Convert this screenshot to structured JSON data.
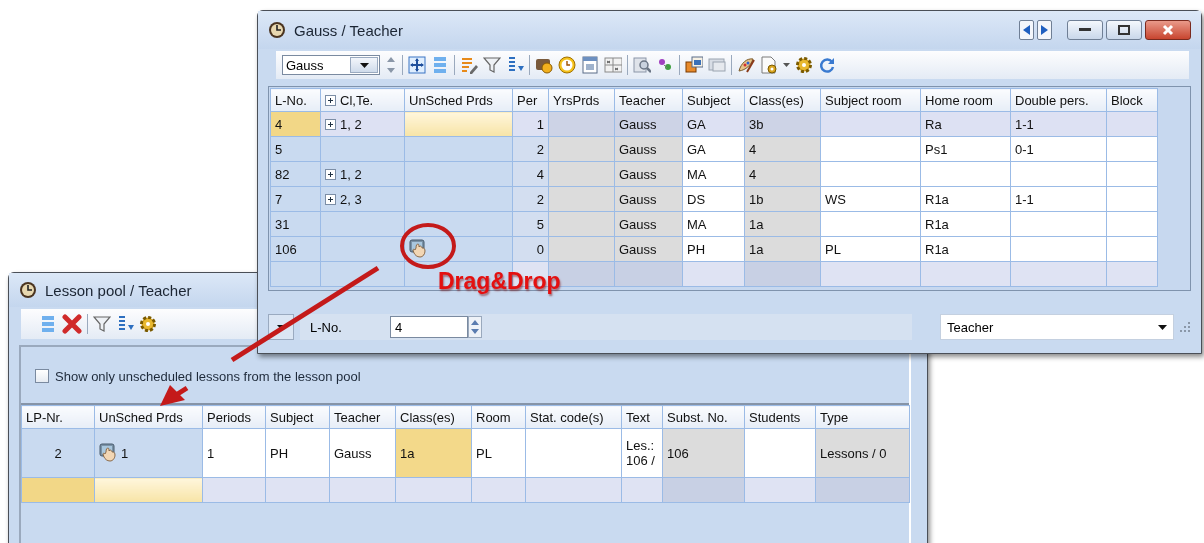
{
  "teacher_window": {
    "title": "Gauss / Teacher",
    "toolbar": {
      "teacher_select": "Gauss"
    },
    "table": {
      "columns": [
        {
          "label": "L-No.",
          "kind": "key"
        },
        {
          "label": "Cl,Te.",
          "kind": "tree"
        },
        {
          "label": "UnSched Prds",
          "kind": "slot"
        },
        {
          "label": "Per",
          "kind": "number"
        },
        {
          "label": "YrsPrds",
          "kind": "grey"
        },
        {
          "label": "Teacher",
          "kind": "grey"
        },
        {
          "label": "Subject",
          "kind": "plain"
        },
        {
          "label": "Class(es)",
          "kind": "grey"
        },
        {
          "label": "Subject room",
          "kind": "plain"
        },
        {
          "label": "Home room",
          "kind": "plain"
        },
        {
          "label": "Double pers.",
          "kind": "plain"
        },
        {
          "label": "Block",
          "kind": "plain"
        }
      ],
      "rows": [
        {
          "selected": true,
          "expandable": true,
          "drag_handle": false,
          "cells": [
            "4",
            "1, 2",
            "",
            "1",
            "",
            "Gauss",
            "GA",
            "3b",
            "",
            "Ra",
            "1-1",
            ""
          ]
        },
        {
          "selected": false,
          "expandable": false,
          "drag_handle": false,
          "cells": [
            "5",
            "",
            "",
            "2",
            "",
            "Gauss",
            "GA",
            "4",
            "",
            "Ps1",
            "0-1",
            ""
          ]
        },
        {
          "selected": false,
          "expandable": true,
          "drag_handle": false,
          "cells": [
            "82",
            "1, 2",
            "",
            "4",
            "",
            "Gauss",
            "MA",
            "4",
            "",
            "",
            "",
            ""
          ]
        },
        {
          "selected": false,
          "expandable": true,
          "drag_handle": false,
          "cells": [
            "7",
            "2, 3",
            "",
            "2",
            "",
            "Gauss",
            "DS",
            "1b",
            "WS",
            "R1a",
            "1-1",
            ""
          ]
        },
        {
          "selected": false,
          "expandable": false,
          "drag_handle": false,
          "cells": [
            "31",
            "",
            "",
            "5",
            "",
            "Gauss",
            "MA",
            "1a",
            "",
            "R1a",
            "",
            ""
          ]
        },
        {
          "selected": false,
          "expandable": false,
          "drag_handle": true,
          "cells": [
            "106",
            "",
            "",
            "0",
            "",
            "Gauss",
            "PH",
            "1a",
            "PL",
            "R1a",
            "",
            ""
          ]
        }
      ],
      "new_row": {
        "selected": false
      }
    },
    "bottom_bar": {
      "field_label": "L-No.",
      "field_value": "4",
      "view_select": "Teacher"
    }
  },
  "annotation": {
    "label": "Drag&Drop"
  },
  "lesson_pool_window": {
    "title": "Lesson pool / Teacher",
    "filter": {
      "label": "Show only unscheduled lessons from the lesson pool",
      "checked": false
    },
    "table": {
      "columns": [
        {
          "label": "LP-Nr.",
          "kind": "key",
          "current": false
        },
        {
          "label": "UnSched Prds",
          "kind": "slot",
          "current": false
        },
        {
          "label": "Periods",
          "kind": "plain",
          "current": false
        },
        {
          "label": "Subject",
          "kind": "plain",
          "current": false
        },
        {
          "label": "Teacher",
          "kind": "plain",
          "current": false
        },
        {
          "label": "Class(es)",
          "kind": "plain",
          "current": true
        },
        {
          "label": "Room",
          "kind": "plain",
          "current": false
        },
        {
          "label": "Stat. code(s)",
          "kind": "plain",
          "current": false
        },
        {
          "label": "Text",
          "kind": "plain",
          "current": false
        },
        {
          "label": "Subst. No.",
          "kind": "grey",
          "current": false
        },
        {
          "label": "Students",
          "kind": "plain",
          "current": false
        },
        {
          "label": "Type",
          "kind": "grey",
          "current": false
        }
      ],
      "rows": [
        {
          "selected": false,
          "drag_handle": true,
          "cells": [
            "2",
            "1",
            "1",
            "PH",
            "Gauss",
            "1a",
            "PL",
            "",
            "Les.: 106 /",
            "106",
            "",
            "Lessons / 0"
          ]
        }
      ],
      "new_row": {
        "selected": true
      }
    }
  }
}
